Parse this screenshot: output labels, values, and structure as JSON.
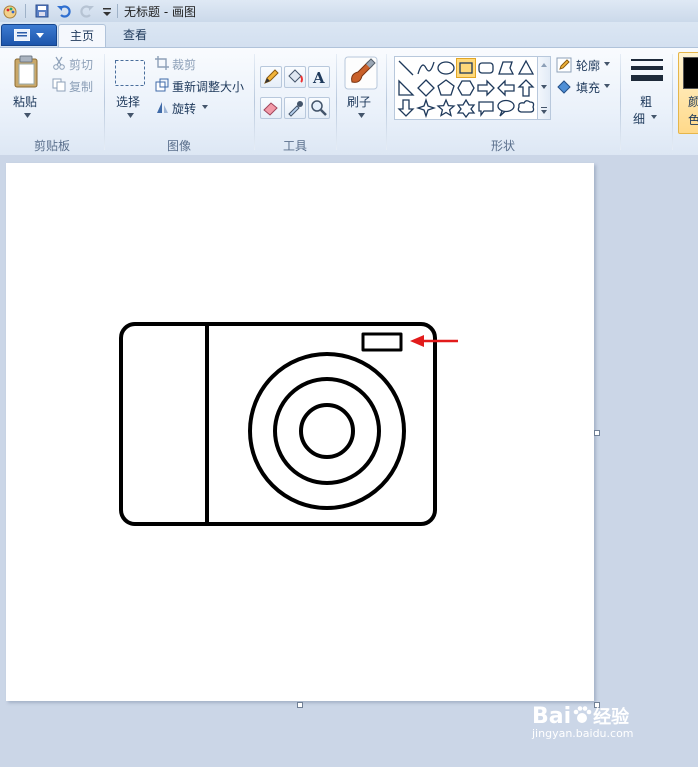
{
  "window": {
    "title": "无标题 - 画图"
  },
  "tabs": [
    {
      "label": "主页",
      "active": true
    },
    {
      "label": "查看",
      "active": false
    }
  ],
  "ribbon": {
    "clipboard": {
      "paste": "粘贴",
      "cut": "剪切",
      "copy": "复制",
      "group": "剪贴板"
    },
    "image": {
      "select": "选择",
      "crop": "裁剪",
      "resize": "重新调整大小",
      "rotate": "旋转",
      "group": "图像"
    },
    "tools": {
      "group": "工具"
    },
    "brushes": {
      "label": "刷子"
    },
    "shapes": {
      "outline": "轮廓",
      "fill": "填充",
      "group": "形状"
    },
    "size": {
      "label_line1": "粗",
      "label_line2": "细"
    },
    "color1": {
      "label_line1": "颜",
      "label_line2": "色"
    }
  },
  "watermark": {
    "brand": "Bai",
    "brand_suffix": "经验",
    "url": "jingyan.baidu.com"
  },
  "colors": {
    "accent_arrow": "#e21b1b",
    "ribbon_text": "#1e395b"
  }
}
